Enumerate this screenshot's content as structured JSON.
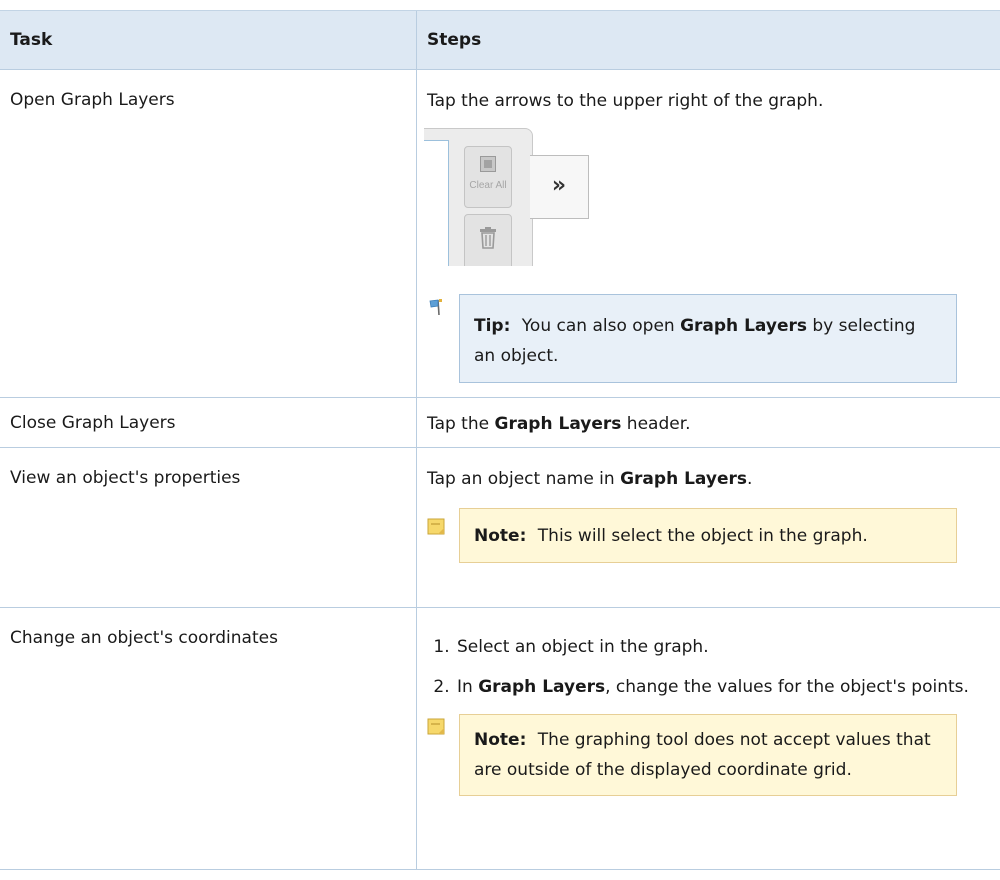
{
  "table": {
    "headers": {
      "task": "Task",
      "steps": "Steps"
    },
    "rows": [
      {
        "task": "Open Graph Layers",
        "step_text": "Tap the arrows to the upper right of the graph.",
        "illustration": {
          "clear_all_label": "Clear All",
          "expand_glyph": "»",
          "icons": [
            "stop-icon",
            "trash-icon",
            "double-chevron-right-icon"
          ]
        },
        "tip": {
          "label": "Tip:",
          "before": "You can also open ",
          "bold": "Graph Layers",
          "after": " by selecting an object.",
          "icon": "flag-icon"
        }
      },
      {
        "task": "Close Graph Layers",
        "before": "Tap the ",
        "bold": "Graph Layers",
        "after": " header."
      },
      {
        "task": "View an object's properties",
        "before": "Tap an object name in ",
        "bold": "Graph Layers",
        "after": ".",
        "note": {
          "label": "Note:",
          "text": "This will select the object in the graph.",
          "icon": "note-icon"
        }
      },
      {
        "task": "Change an object's coordinates",
        "steps": [
          {
            "number": "1.",
            "text": "Select an object in the graph."
          },
          {
            "number": "2.",
            "before": "In ",
            "bold": "Graph Layers",
            "after": ", change the values for the object's points."
          }
        ],
        "note": {
          "label": "Note:",
          "text": "The graphing tool does not accept values that are outside of the displayed coordinate grid.",
          "icon": "note-icon"
        }
      }
    ]
  },
  "colors": {
    "header_bg": "#dde8f3",
    "border": "#b9cde0",
    "tip_bg": "#e8f0f8",
    "note_bg": "#fff8d8"
  }
}
